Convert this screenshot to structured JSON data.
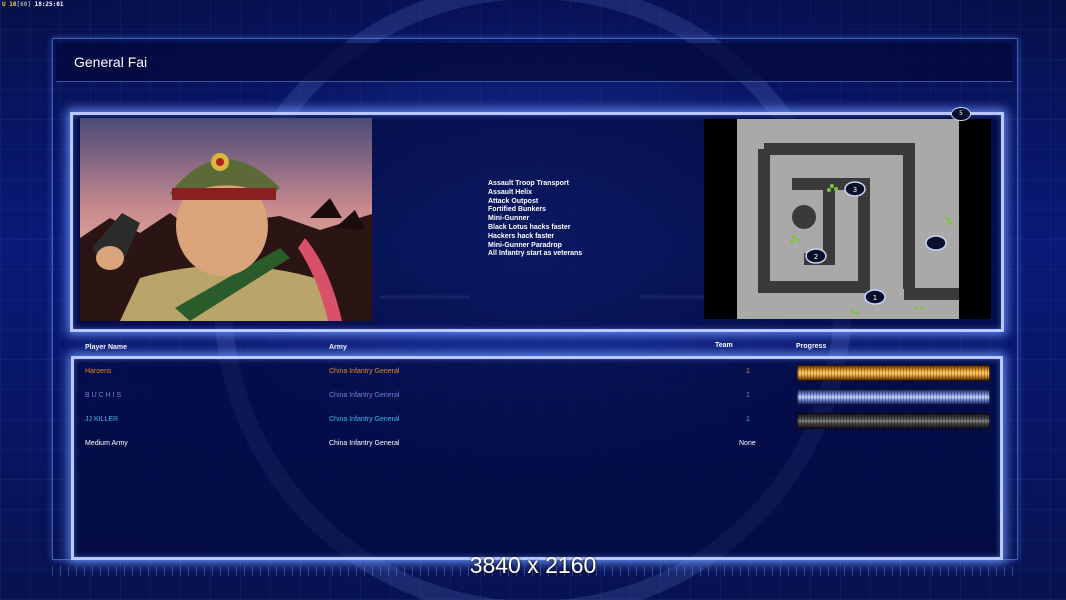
{
  "status": {
    "unit": "U",
    "value": "10",
    "sub": "60",
    "clock": "18:25:01"
  },
  "title": "General Fai",
  "upgrades": [
    "Assault Troop Transport",
    "Assault Helix",
    "Attack Outpost",
    "Fortified Bunkers",
    "Mini-Gunner",
    "Black Lotus hacks faster",
    "Hackers hack faster",
    "Mini-Gunner Paradrop",
    "All Infantry start as veterans"
  ],
  "minimap": {
    "markers": [
      "1",
      "2",
      "3",
      "5"
    ]
  },
  "table": {
    "headers": {
      "player": "Player Name",
      "army": "Army",
      "team": "Team",
      "progress": "Progress"
    },
    "rows": [
      {
        "player": "Haroens",
        "army": "China Infantry General",
        "team": "1",
        "color": "#e38a1c",
        "progress_style": "orange"
      },
      {
        "player": "B U C H I S",
        "army": "China Infantry General",
        "team": "1",
        "color": "#6a86d6",
        "progress_style": "blue"
      },
      {
        "player": "JJ KILLER",
        "army": "China Infantry General",
        "team": "1",
        "color": "#3fb6e8",
        "progress_style": "grey"
      },
      {
        "player": "Medium Army",
        "army": "China Infantry General",
        "team": "None",
        "color": "#ffffff",
        "progress_style": "none"
      }
    ]
  },
  "watermark": "3840 x 2160"
}
